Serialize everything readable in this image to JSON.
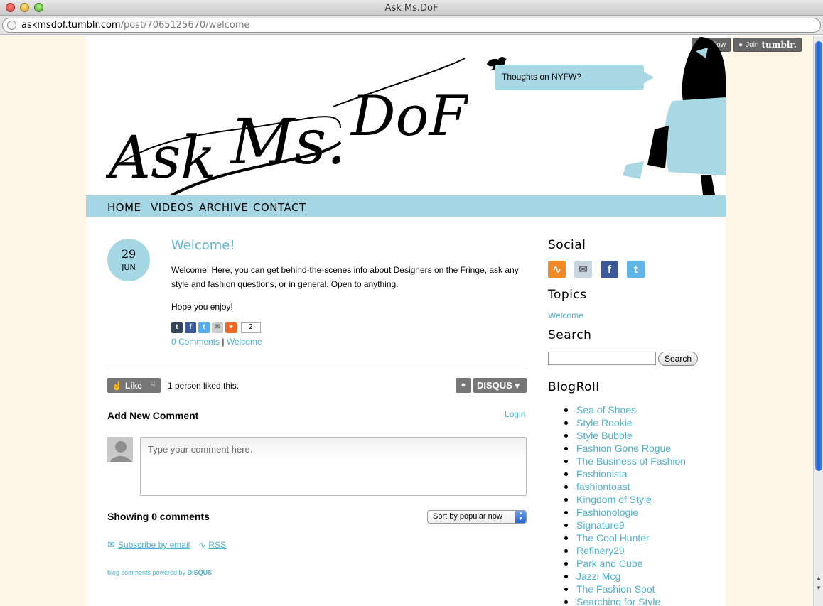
{
  "window": {
    "title": "Ask Ms.DoF",
    "url_host": "askmsdof.tumblr.com",
    "url_path": "/post/7065125670/welcome"
  },
  "header": {
    "logo_text": "Ask Ms. DoF",
    "follow_label": "Follow",
    "join_label": "Join",
    "join_brand": "tumblr.",
    "tweet": "Thoughts on NYFW?"
  },
  "nav": {
    "items": [
      "HOME",
      "VIDEOS",
      "ARCHIVE",
      "CONTACT"
    ]
  },
  "post": {
    "day": "29",
    "month": "JUN",
    "title": "Welcome!",
    "paragraph1": "Welcome! Here, you can get behind-the-scenes info about Designers on the Fringe, ask any style and fashion questions, or in general. Open to anything.",
    "paragraph2": "Hope you enjoy!",
    "share_count": "2",
    "comments_link": "0 Comments",
    "meta_sep": "|",
    "tag_link": "Welcome"
  },
  "disqus": {
    "like_label": "Like",
    "liked_text": "1 person liked this.",
    "brand": "DISQUS",
    "add_comment": "Add New Comment",
    "login": "Login",
    "comment_placeholder": "Type your comment here.",
    "showing": "Showing 0 comments",
    "sort_value": "Sort by popular now",
    "subscribe": "Subscribe by email",
    "rss": "RSS",
    "powered_prefix": "blog comments powered by",
    "powered_brand": "DISQUS"
  },
  "sidebar": {
    "social_heading": "Social",
    "topics_heading": "Topics",
    "topic_link": "Welcome",
    "search_heading": "Search",
    "search_button": "Search",
    "blogroll_heading": "BlogRoll",
    "blogroll": [
      "Sea of Shoes",
      "Style Rookie",
      "Style Bubble",
      "Fashion Gone Rogue",
      "The Business of Fashion",
      "Fashionista",
      "fashiontoast",
      "Kingdom of Style",
      "Fashionologie",
      "Signature9",
      "The Cool Hunter",
      "Refinery29",
      "Park and Cube",
      "Jazzi Mcg",
      "The Fashion Spot",
      "Searching for Style"
    ]
  },
  "colors": {
    "accent": "#a5d6e3",
    "link": "#4eb0cc",
    "page_bg": "#fdf5e6"
  }
}
